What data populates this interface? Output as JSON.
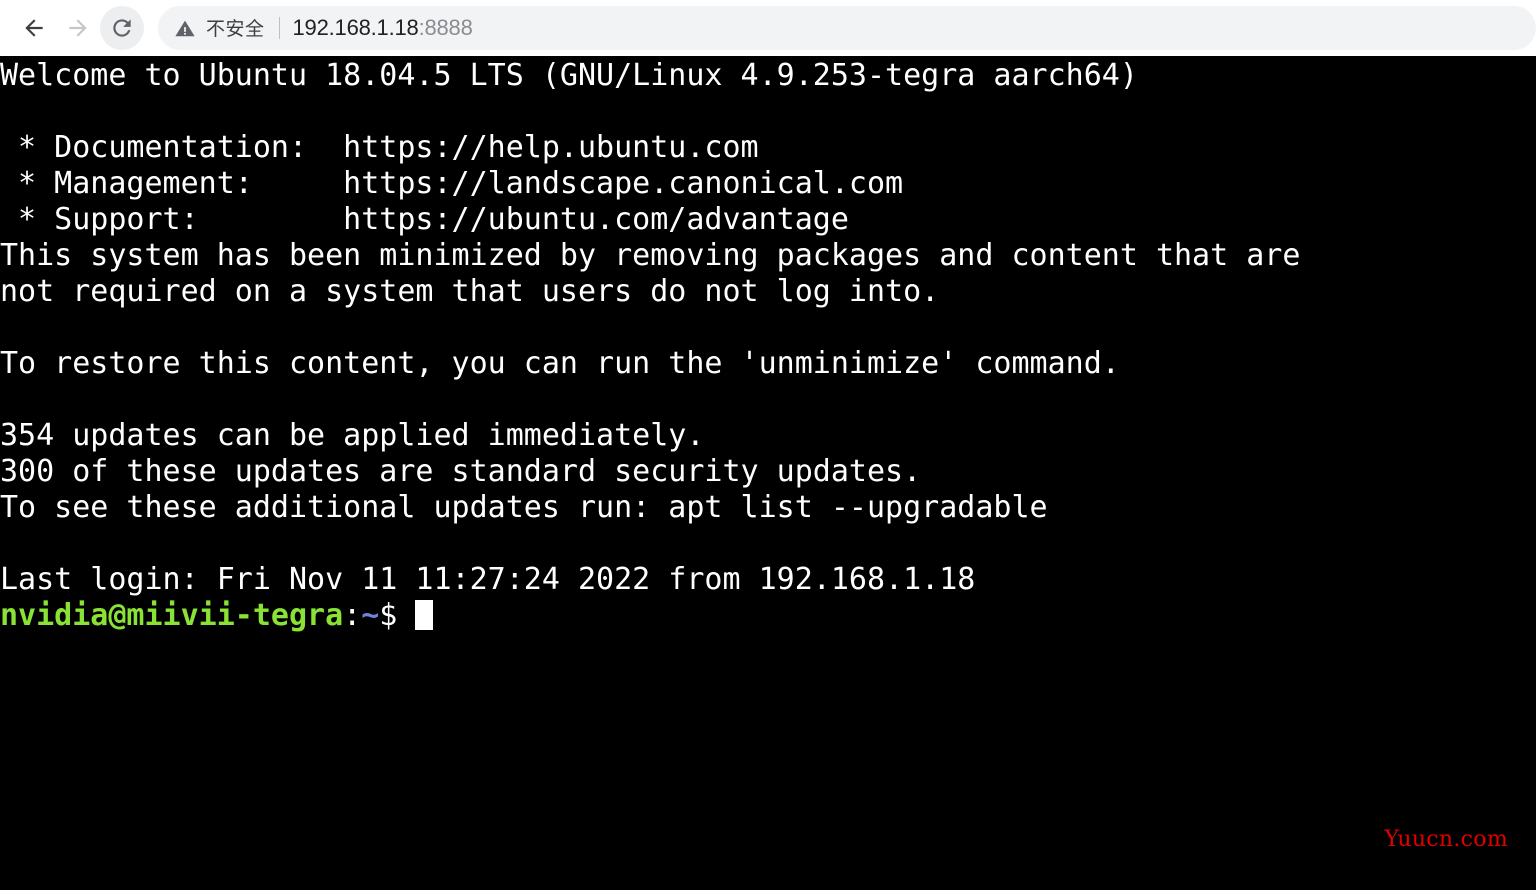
{
  "browser": {
    "back_label": "Back",
    "forward_label": "Forward",
    "reload_label": "Reload this page",
    "back_icon": "arrow-left-icon",
    "forward_icon": "arrow-right-icon",
    "reload_icon": "reload-icon",
    "omnibox": {
      "security_icon": "warning-triangle-icon",
      "security_text": "不安全",
      "url_host": "192.168.1.18",
      "url_port": ":8888",
      "full_url": "192.168.1.18:8888"
    },
    "colors": {
      "toolbar_bg": "#ffffff",
      "omnibox_bg": "#f1f3f4",
      "url_host_color": "#202124",
      "url_port_color": "#8a8d91",
      "icon_active": "#5f6368",
      "icon_disabled": "#bdc1c6"
    }
  },
  "terminal": {
    "colors": {
      "background": "#000000",
      "foreground": "#ffffff",
      "prompt_user_host": "#8ae234",
      "prompt_path": "#6d85d8",
      "cursor": "#ffffff"
    },
    "lines": [
      "Welcome to Ubuntu 18.04.5 LTS (GNU/Linux 4.9.253-tegra aarch64)",
      "",
      " * Documentation:  https://help.ubuntu.com",
      " * Management:     https://landscape.canonical.com",
      " * Support:        https://ubuntu.com/advantage",
      "This system has been minimized by removing packages and content that are",
      "not required on a system that users do not log into.",
      "",
      "To restore this content, you can run the 'unminimize' command.",
      "",
      "354 updates can be applied immediately.",
      "300 of these updates are standard security updates.",
      "To see these additional updates run: apt list --upgradable",
      "",
      "Last login: Fri Nov 11 11:27:24 2022 from 192.168.1.18"
    ],
    "prompt": {
      "user_host": "nvidia@miivii-tegra",
      "separator": ":",
      "path": "~",
      "sigil": "$",
      "trailing_space": " ",
      "command": ""
    }
  },
  "watermark": {
    "text": "Yuucn.com",
    "color": "#e00000"
  }
}
